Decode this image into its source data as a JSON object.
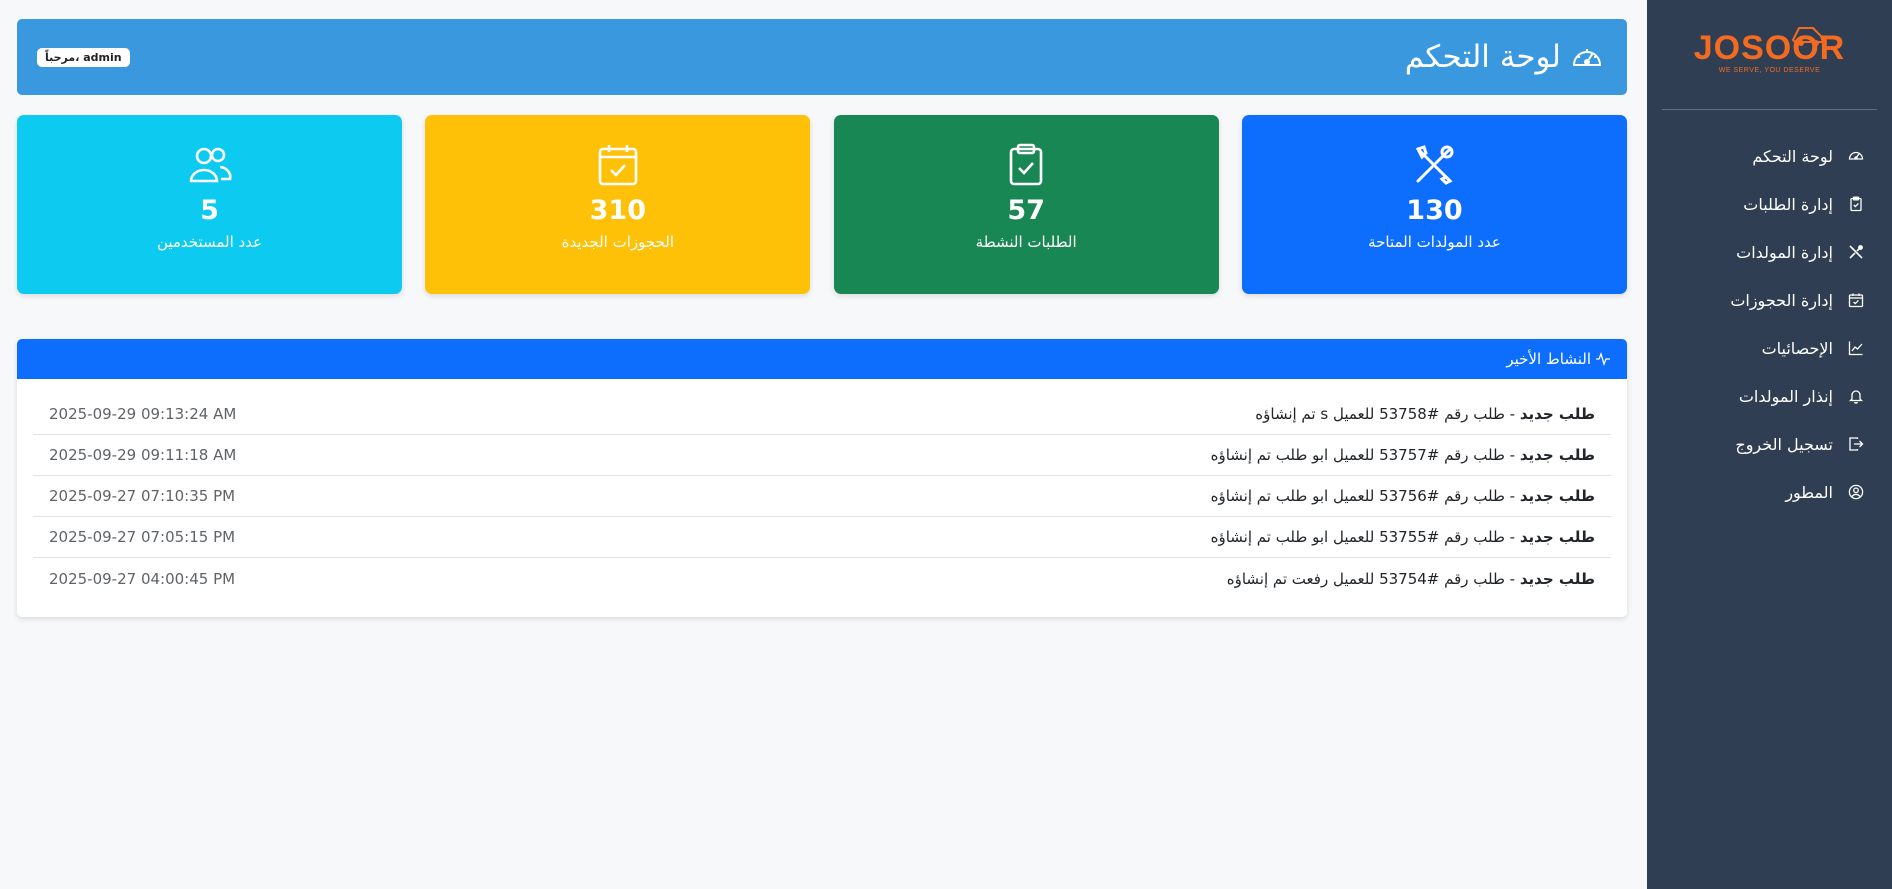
{
  "sidebar": {
    "logo": {
      "word": "JOSOOR",
      "tagline": "WE SERVE, YOU DESERVE"
    },
    "items": [
      {
        "label": "لوحة التحكم",
        "icon": "speedometer-icon"
      },
      {
        "label": "إدارة الطلبات",
        "icon": "clipboard-icon"
      },
      {
        "label": "إدارة المولدات",
        "icon": "tools-icon"
      },
      {
        "label": "إدارة الحجوزات",
        "icon": "calendar-check-icon"
      },
      {
        "label": "الإحصائيات",
        "icon": "chart-line-icon"
      },
      {
        "label": "إنذار المولدات",
        "icon": "bell-icon"
      },
      {
        "label": "تسجيل الخروج",
        "icon": "logout-icon"
      },
      {
        "label": "المطور",
        "icon": "user-circle-icon"
      }
    ]
  },
  "header": {
    "title": "لوحة التحكم",
    "welcome": "مرحباً، admin"
  },
  "cards": [
    {
      "value": "130",
      "label": "عدد المولدات المتاحة",
      "color": "#0d6efd",
      "icon": "tools-icon"
    },
    {
      "value": "57",
      "label": "الطلبات النشطة",
      "color": "#198754",
      "icon": "clipboard-check-icon"
    },
    {
      "value": "310",
      "label": "الحجوزات الجديدة",
      "color": "#ffc107",
      "icon": "calendar-check-icon"
    },
    {
      "value": "5",
      "label": "عدد المستخدمين",
      "color": "#0dcaf0",
      "icon": "users-icon"
    }
  ],
  "activity": {
    "title": "النشاط الأخير",
    "rows": [
      {
        "kind": "طلب جديد",
        "text": " - طلب رقم #53758 للعميل s تم إنشاؤه",
        "time": "2025-09-29 09:13:24 AM"
      },
      {
        "kind": "طلب جديد",
        "text": " - طلب رقم #53757 للعميل ابو طلب تم إنشاؤه",
        "time": "2025-09-29 09:11:18 AM"
      },
      {
        "kind": "طلب جديد",
        "text": " - طلب رقم #53756 للعميل ابو طلب تم إنشاؤه",
        "time": "2025-09-27 07:10:35 PM"
      },
      {
        "kind": "طلب جديد",
        "text": " - طلب رقم #53755 للعميل ابو طلب تم إنشاؤه",
        "time": "2025-09-27 07:05:15 PM"
      },
      {
        "kind": "طلب جديد",
        "text": " - طلب رقم #53754 للعميل رفعت تم إنشاؤه",
        "time": "2025-09-27 04:00:45 PM"
      }
    ]
  }
}
